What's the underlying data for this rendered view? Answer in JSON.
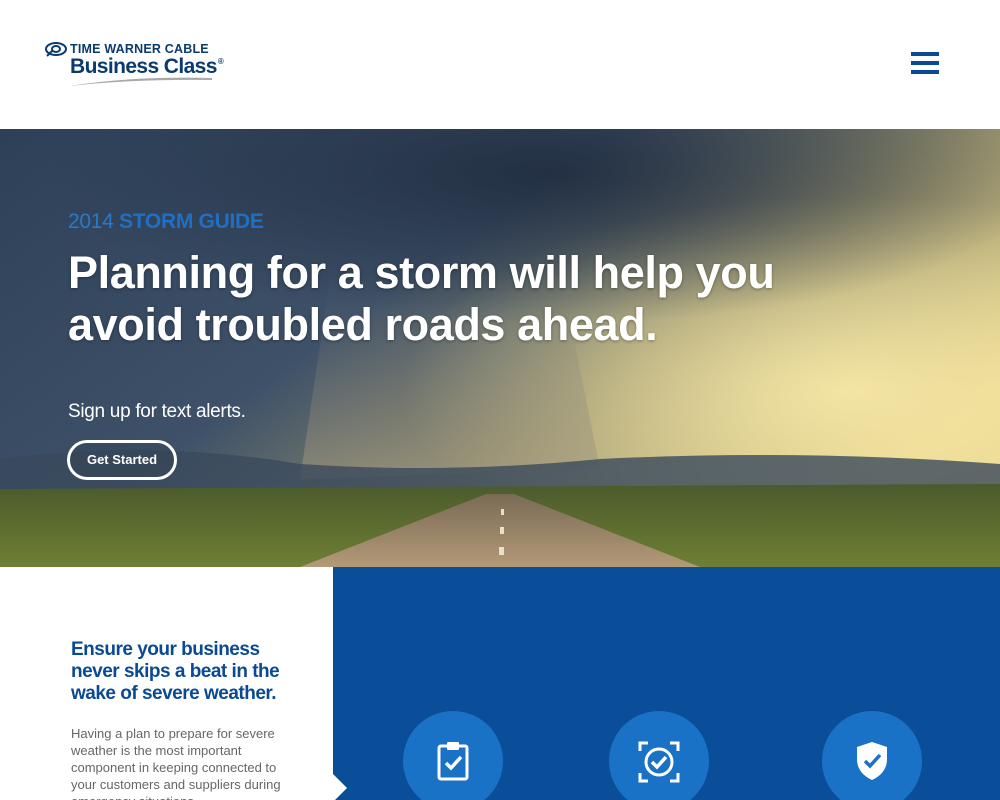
{
  "header": {
    "logo": {
      "top_line": "TIME WARNER CABLE",
      "main": "Business Class",
      "reg_mark": "®"
    },
    "menu_icon": "hamburger-menu-icon"
  },
  "hero": {
    "eyebrow_year": "2014",
    "eyebrow_title": "STORM GUIDE",
    "headline": "Planning for a storm will help you avoid troubled roads ahead.",
    "subline": "Sign up for text alerts.",
    "cta_label": "Get Started"
  },
  "intro": {
    "lead": "Ensure your business never skips a beat in the wake of severe weather.",
    "body": "Having a plan to prepare for severe weather is the most important component in keeping connected to your customers and suppliers during emergency situations."
  },
  "features": {
    "icons": [
      "clipboard-check-icon",
      "target-check-icon",
      "shield-check-icon"
    ]
  },
  "colors": {
    "brand_navy": "#0b3a6e",
    "accent_blue": "#2a78c9",
    "panel_blue": "#0a4e99",
    "circle_blue": "#1a72c7"
  }
}
